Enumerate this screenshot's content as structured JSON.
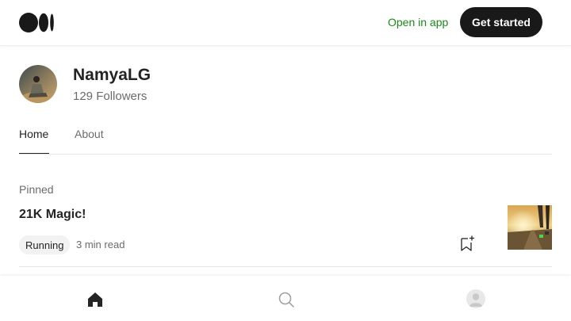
{
  "header": {
    "logo_icon": "medium-logo-icon",
    "open_in_app": "Open in app",
    "get_started": "Get started"
  },
  "profile": {
    "name": "NamyaLG",
    "followers": "129 Followers",
    "avatar_icon": "profile-photo"
  },
  "tabs": [
    {
      "label": "Home",
      "active": true
    },
    {
      "label": "About",
      "active": false
    }
  ],
  "pinned": {
    "section_label": "Pinned",
    "post": {
      "title": "21K Magic!",
      "tag": "Running",
      "read_time": "3 min read",
      "bookmark_icon": "bookmark-add-icon",
      "thumbnail": "running-road-photo"
    }
  },
  "bottom_nav": {
    "items": [
      "home-icon",
      "search-icon",
      "profile-icon"
    ]
  },
  "colors": {
    "accent_green": "#1a8917",
    "button_dark": "#191919",
    "text": "#242424",
    "muted": "#6b6b6b"
  }
}
